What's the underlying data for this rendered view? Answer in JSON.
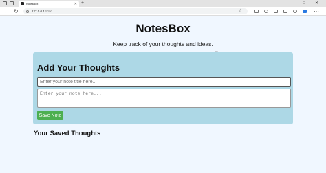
{
  "browser": {
    "tab_title": "NotesBox",
    "url_host": "127.0.0.1",
    "url_port": ":5000"
  },
  "page": {
    "title": "NotesBox",
    "subtitle": "Keep track of your thoughts and ideas."
  },
  "form": {
    "heading": "Add Your Thoughts",
    "title_placeholder": "Enter your note title here...",
    "content_placeholder": "Enter your note here...",
    "save_label": "Save Note"
  },
  "saved": {
    "heading": "Your Saved Thoughts"
  },
  "colors": {
    "page_bg": "#f0f7ff",
    "card_bg": "#add8e6",
    "save_button": "#4caf50"
  }
}
